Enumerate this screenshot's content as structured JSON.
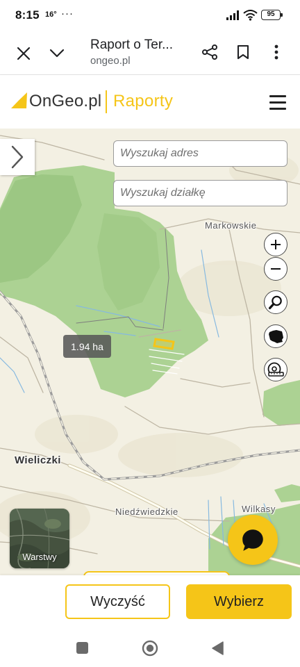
{
  "status_bar": {
    "time": "8:15",
    "temperature": "16°",
    "overflow": "···",
    "battery": "95"
  },
  "browser": {
    "title": "Raport o Ter...",
    "url": "ongeo.pl"
  },
  "header": {
    "logo": "OnGeo.pl",
    "section": "Raporty"
  },
  "map": {
    "search_address": {
      "placeholder": "Wyszukaj adres"
    },
    "search_parcel": {
      "placeholder": "Wyszukaj działkę"
    },
    "places": [
      {
        "name": "Markowskie"
      },
      {
        "name": "Wieliczki"
      },
      {
        "name": "Niedźwiedzkie"
      },
      {
        "name": "Wilkasy"
      }
    ],
    "selected_parcel_area": "1.94 ha",
    "layers_label": "Warstwy"
  },
  "actions": {
    "clear": "Wyczyść",
    "select": "Wybierz"
  },
  "icons": {
    "browser": [
      "close-icon",
      "chevron-down-icon",
      "share-icon",
      "bookmark-icon",
      "more-vert-icon"
    ],
    "header": [
      "ongeo-logo-icon",
      "hamburger-menu-icon"
    ],
    "map_controls": [
      "chevron-right-icon",
      "plus-icon",
      "minus-icon",
      "search-icon",
      "poland-map-icon",
      "measure-tape-icon",
      "chat-icon"
    ],
    "navigation": [
      "recent-apps-icon",
      "home-icon",
      "back-icon"
    ]
  },
  "colors": {
    "accent": "#f5c518",
    "forest": "#acd293",
    "map_background": "#f3f0e3",
    "dark_text": "#222222"
  }
}
